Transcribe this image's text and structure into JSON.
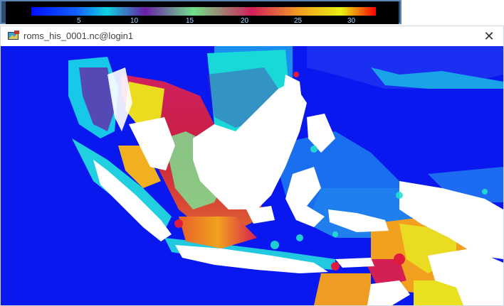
{
  "window": {
    "title": "roms_his_0001.nc@login1",
    "close_icon": "close-icon",
    "app_icon": "ncview-app-icon"
  },
  "colorbar": {
    "tick_labels": [
      "5",
      "10",
      "15",
      "20",
      "25",
      "30"
    ],
    "colormap": [
      "#0010ff",
      "#1060ff",
      "#10d0e0",
      "#6a1fa6",
      "#6fe08a",
      "#d21e5a",
      "#f2a020",
      "#e8f010",
      "#ff0000"
    ]
  },
  "map": {
    "ocean_deep_color": "#0a18f0",
    "ocean_shelf_color": "#1a7cf0",
    "land_color": "#ffffff"
  }
}
